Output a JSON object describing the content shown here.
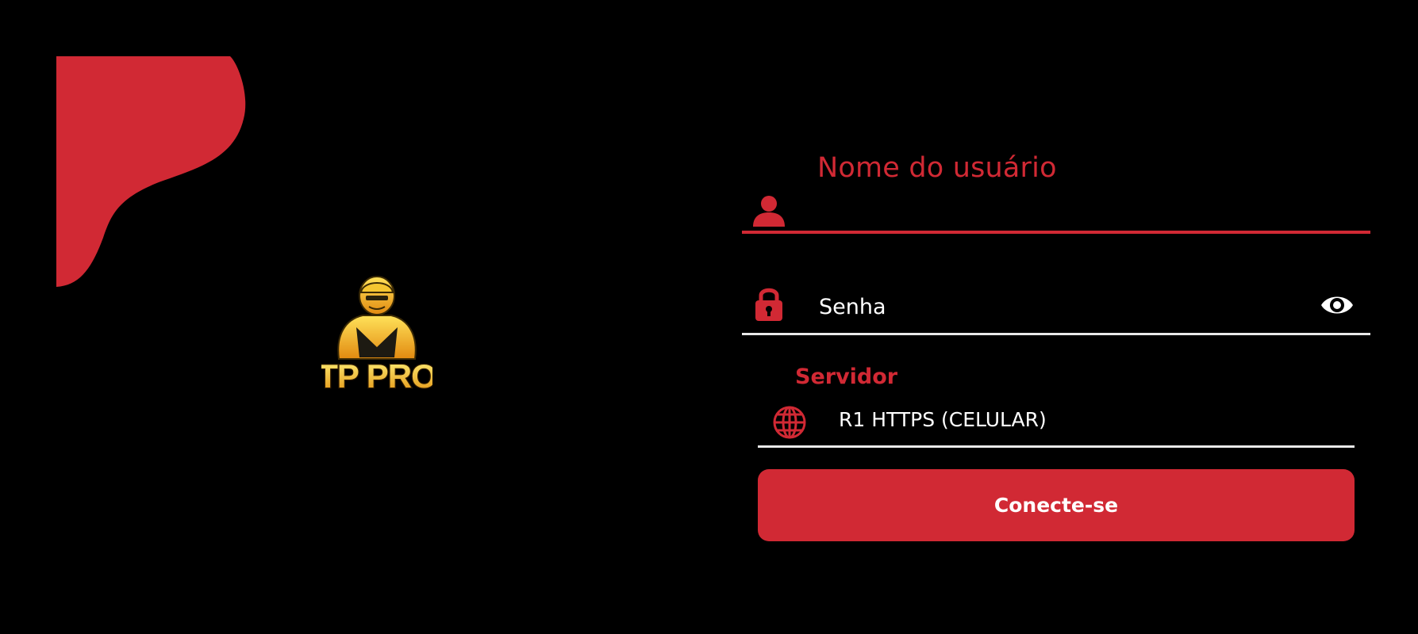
{
  "colors": {
    "background": "#000000",
    "accent": "#d12934",
    "text": "#ffffff",
    "underline_inactive": "#e9e9e9"
  },
  "logo": {
    "text": "TP PRO"
  },
  "login_form": {
    "username": {
      "label": "Nome do usuário",
      "value": "",
      "icon": "user-icon"
    },
    "password": {
      "placeholder": "Senha",
      "icon": "lock-icon",
      "toggle_icon": "eye-icon"
    },
    "server": {
      "label": "Servidor",
      "selected": "R1 HTTPS (CELULAR)",
      "icon": "globe-icon"
    },
    "connect_label": "Conecte-se"
  }
}
